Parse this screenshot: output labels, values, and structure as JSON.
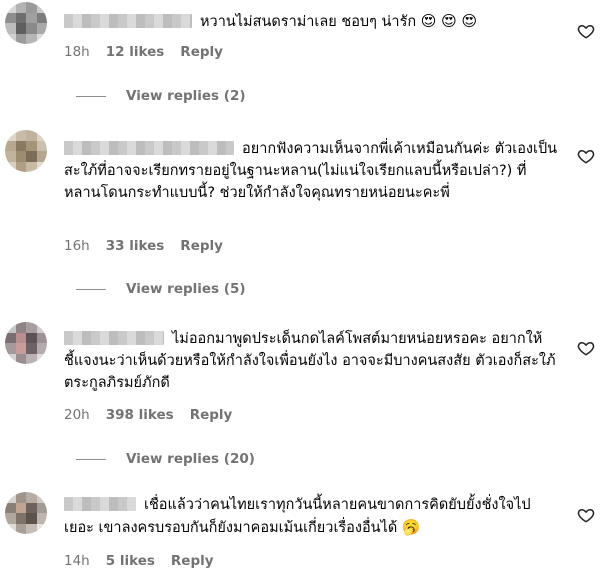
{
  "comments": [
    {
      "text": "หวานไม่สนดราม่าเลย ชอบๆ น่ารัก",
      "emoji": "😍 😍 😍",
      "time": "18h",
      "likes": "12 likes",
      "reply": "Reply",
      "view_replies": "View replies (2)"
    },
    {
      "text": "อยากฟังความเห็นจากพี่เค้าเหมือนกันค่ะ ตัวเองเป็นสะใภ้ที่อาจจะเรียกทรายอยู่ในฐานะหลาน(ไม่แน่ใจเรียกแลบนี้หรือเปล่า?) ที่หลานโดนกระทำแบบนี้? ช่วยให้กำลังใจคุณทรายหน่อยนะคะพี่",
      "emoji": "",
      "time": "16h",
      "likes": "33 likes",
      "reply": "Reply",
      "view_replies": "View replies (5)"
    },
    {
      "text": "ไม่ออกมาพูดประเด็นกดไลค์โพสต์มายหน่อยหรอคะ อยากให้ชี้แจงนะว่าเห็นด้วยหรือให้กำลังใจเพื่อนยังไง อาจจะมีบางคนสงสัย ตัวเองก็สะใภ้ตระกูลภิรมย์ภักดี",
      "emoji": "",
      "time": "20h",
      "likes": "398 likes",
      "reply": "Reply",
      "view_replies": "View replies (20)"
    },
    {
      "text": "เชื่อแล้วว่าคนไทยเราทุกวันนี้หลายคนขาดการคิดยับยั้งชั่งใจไปเยอะ เขาลงครบรอบกันก็ยังมาคอมเม้นเกี่ยวเรื่องอื่นได้",
      "emoji": "🥱",
      "time": "14h",
      "likes": "5 likes",
      "reply": "Reply",
      "view_replies": ""
    }
  ],
  "icons": {
    "like": "heart-outline-icon"
  },
  "colors": {
    "meta": "#737373",
    "text": "#000000"
  }
}
